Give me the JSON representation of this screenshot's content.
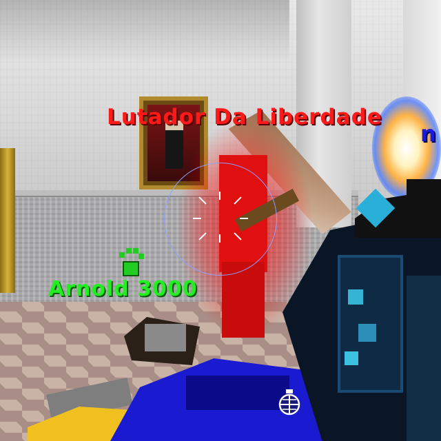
{
  "scene": {
    "type": "first-person shooter (voxel style)",
    "environment": "mansion hall"
  },
  "players": {
    "enemy": {
      "name": "Lutador Da Liberdade",
      "color": "#ff1a1a"
    },
    "ally": {
      "name": "Arnold 3000",
      "color": "#22ee22"
    },
    "offscreen": {
      "name": "n",
      "color": "#1a1adc"
    }
  },
  "hud": {
    "crosshair": {
      "ring_color": "#8fa0ff",
      "tick_color": "#ffffff"
    },
    "icons": {
      "pet": "paw-icon",
      "grenade": "grenade-icon"
    }
  },
  "colors": {
    "enemy_highlight": "#e01010",
    "weapon_dark": "#0a1626",
    "weapon_accent": "#35b4d6",
    "block_blue": "#1a1ad0",
    "block_yellow": "#f0c020"
  }
}
